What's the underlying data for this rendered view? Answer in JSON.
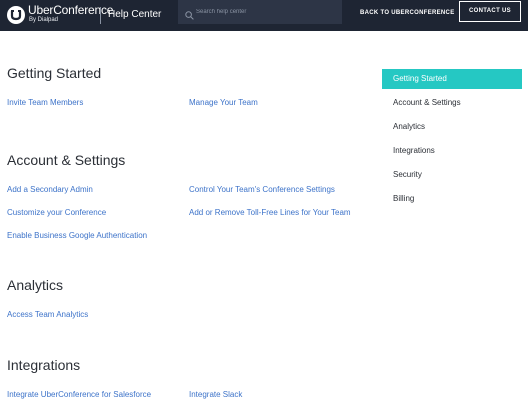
{
  "header": {
    "logo_name": "UberConference",
    "logo_sub": "By Dialpad",
    "help_center": "Help Center",
    "search_placeholder": "Search help center",
    "back_link": "BACK TO UBERCONFERENCE",
    "contact_button": "CONTACT US"
  },
  "sections": [
    {
      "title": "Getting Started",
      "links": [
        "Invite Team Members",
        "Manage Your Team"
      ]
    },
    {
      "title": "Account & Settings",
      "links": [
        "Add a Secondary Admin",
        "Control Your Team's Conference Settings",
        "Customize your Conference",
        "Add or Remove Toll-Free Lines for Your Team",
        "Enable Business Google Authentication"
      ]
    },
    {
      "title": "Analytics",
      "links": [
        "Access Team Analytics"
      ]
    },
    {
      "title": "Integrations",
      "links": [
        "Integrate UberConference for Salesforce",
        "Integrate Slack"
      ]
    }
  ],
  "sidebar": {
    "active_index": 0,
    "active_color": "#25c8c3",
    "items": [
      "Getting Started",
      "Account & Settings",
      "Analytics",
      "Integrations",
      "Security",
      "Billing"
    ]
  },
  "colors": {
    "header_bg": "#1e2533",
    "link": "#3d73c9"
  }
}
